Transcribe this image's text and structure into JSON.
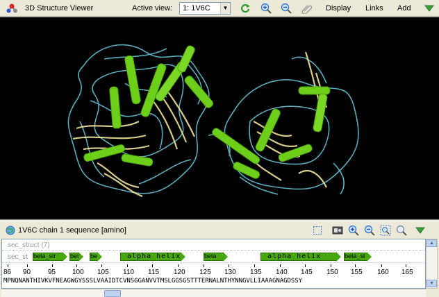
{
  "toolbar": {
    "app_icon": "molecule-icon",
    "title": "3D Structure Viewer",
    "active_view_label": "Active view:",
    "active_view_value": "1: 1V6C",
    "icons": [
      "refresh-icon",
      "zoom-in-icon",
      "zoom-out-icon",
      "link-icon"
    ],
    "menus": [
      "Display",
      "Links",
      "Add"
    ],
    "collapse_icon": "triangle-down-icon",
    "colors": {
      "refresh": "#2e9a2e",
      "zoom": "#3a7bd5",
      "collapse": "#3aa13a"
    }
  },
  "viewer": {
    "background": "#000000",
    "colors": {
      "helix": "#6ecf1a",
      "strand": "#efe39a",
      "coil": "#5fb8c8"
    }
  },
  "sequence_panel": {
    "title": "1V6C chain 1 sequence [amino]",
    "tool_icons": [
      "select-box-icon",
      "panel-icon",
      "zoom-in-icon",
      "zoom-out-icon",
      "fit-icon",
      "search-icon",
      "triangle-down-icon"
    ],
    "rows": {
      "sec_struct_summary": "sec_struct (7)",
      "sec_struct_label": "sec_st"
    },
    "features": [
      {
        "label": "beta_str",
        "type": "strand"
      },
      {
        "label": "bet",
        "type": "strand"
      },
      {
        "label": "bet",
        "type": "strand"
      },
      {
        "label": "alpha helix",
        "type": "helix"
      },
      {
        "label": "beta",
        "type": "strand"
      },
      {
        "label": "alpha helix",
        "type": "helix"
      },
      {
        "label": "beta_st",
        "type": "strand"
      }
    ],
    "ruler": [
      "86",
      "90",
      "95",
      "100",
      "105",
      "110",
      "115",
      "120",
      "125",
      "130",
      "135",
      "140",
      "145",
      "150",
      "155",
      "160",
      "165"
    ],
    "sequence": "MPNQNANTHIVKVFNEAGWGYSSSLVAAIDTCVNSGGANVVTMSLGGSGSTTTERNALNTHYNNGVLLIAAAGNAGDSSY"
  }
}
